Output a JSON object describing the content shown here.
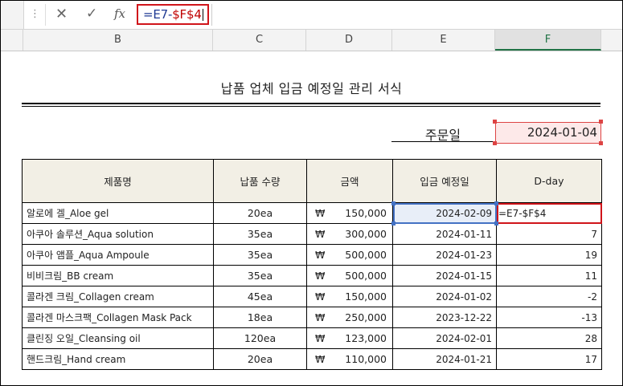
{
  "formula_bar": {
    "formula_prefix": "=E7-",
    "formula_ref": "$F$4",
    "cancel_icon": "x-icon",
    "enter_icon": "check-icon",
    "fx_label": "fx"
  },
  "columns": [
    "B",
    "C",
    "D",
    "E",
    "F"
  ],
  "sheet": {
    "title": "납품 업체 입금 예정일 관리 서식",
    "order_label": "주문일",
    "order_date": "2024-01-04"
  },
  "table": {
    "headers": [
      "제품명",
      "납품 수량",
      "금액",
      "입금 예정일",
      "D-day"
    ],
    "currency": "₩",
    "rows": [
      {
        "name": "알로에 겔_Aloe gel",
        "qty": "20ea",
        "amount": "150,000",
        "date": "2024-02-09",
        "dday": "=E7-$F$4"
      },
      {
        "name": "아쿠아 솔루션_Aqua solution",
        "qty": "35ea",
        "amount": "300,000",
        "date": "2024-01-11",
        "dday": "7"
      },
      {
        "name": "아쿠아 앰플_Aqua Ampoule",
        "qty": "35ea",
        "amount": "500,000",
        "date": "2024-01-23",
        "dday": "19"
      },
      {
        "name": "비비크림_BB cream",
        "qty": "35ea",
        "amount": "500,000",
        "date": "2024-01-15",
        "dday": "11"
      },
      {
        "name": "콜라겐 크림_Collagen cream",
        "qty": "45ea",
        "amount": "150,000",
        "date": "2024-01-02",
        "dday": "-2"
      },
      {
        "name": "콜라겐 마스크팩_Collagen Mask Pack",
        "qty": "18ea",
        "amount": "250,000",
        "date": "2023-12-22",
        "dday": "-13"
      },
      {
        "name": "클린징 오일_Cleansing oil",
        "qty": "120ea",
        "amount": "123,000",
        "date": "2024-02-01",
        "dday": "28"
      },
      {
        "name": "핸드크림_Hand cream",
        "qty": "20ea",
        "amount": "110,000",
        "date": "2024-01-21",
        "dday": "17"
      }
    ]
  },
  "colors": {
    "formula_ref": "#c00000",
    "formula_box": "#d0141a",
    "header_fill": "#f2efe5",
    "order_fill": "#fde9e9",
    "selection": "#4472c4",
    "active_column": "#217346"
  }
}
